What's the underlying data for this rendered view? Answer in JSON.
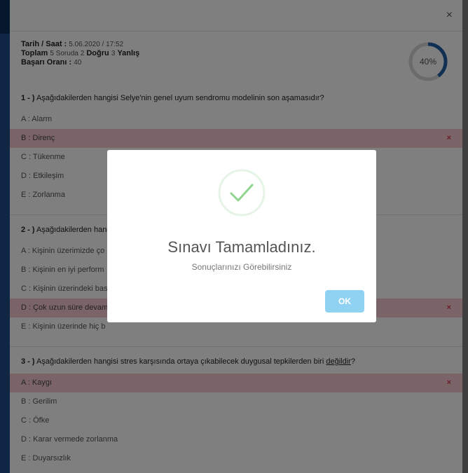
{
  "summary": {
    "date_label": "Tarih / Saat :",
    "date_value": "5.06.2020 / 17:52",
    "total_label": "Toplam",
    "total_text": "5 Soruda 2",
    "correct_label": "Doğru",
    "wrong_count": "3",
    "wrong_label": "Yanlış",
    "rate_label": "Başarı Oranı :",
    "rate_value": "40",
    "progress_text": "40%",
    "progress_value": 40
  },
  "questions": [
    {
      "number": "1 - )",
      "text": "Aşağıdakilerden hangisi Selye'nin genel uyum sendromu modelinin son aşamasıdır?",
      "options": [
        {
          "label": "A : Alarm"
        },
        {
          "label": "B : Direnç",
          "mark": "×"
        },
        {
          "label": "C : Tükenme"
        },
        {
          "label": "D : Etkileşim"
        },
        {
          "label": "E : Zorlanma"
        }
      ]
    },
    {
      "number": "2 - )",
      "text": "Aşağıdakilerden hang",
      "options": [
        {
          "label": "A : Kişinin üzerimizde ço"
        },
        {
          "label": "B : Kişinin en iyi perform"
        },
        {
          "label": "C : Kişinin üzerindeki bas"
        },
        {
          "label": "D : Çok uzun süre devam",
          "mark": "×"
        },
        {
          "label": "E : Kişinin üzerinde hiç b"
        }
      ]
    },
    {
      "number": "3 - )",
      "text_before": "Aşağıdakilerden hangisi stres karşısında ortaya çıkabilecek duygusal tepkilerden biri",
      "text_underlined": "değildir",
      "text_after": "?",
      "options": [
        {
          "label": "A : Kaygı",
          "mark": "×"
        },
        {
          "label": "B : Gerilim"
        },
        {
          "label": "C : Öfke"
        },
        {
          "label": "D : Karar vermede zorlanma"
        },
        {
          "label": "E : Duyarsızlık"
        }
      ]
    }
  ],
  "close_icon": "×",
  "modal": {
    "title": "Sınavı Tamamladınız.",
    "text": "Sonuçlarınızı Görebilirsiniz",
    "ok_label": "OK",
    "icon": "check-icon"
  },
  "colors": {
    "wrong_bg": "#f7c8cf",
    "wrong_mark": "#d23a4e",
    "progress": "#1f5fa6",
    "ok_button": "#8fd2f2",
    "check": "#8fd48f"
  }
}
